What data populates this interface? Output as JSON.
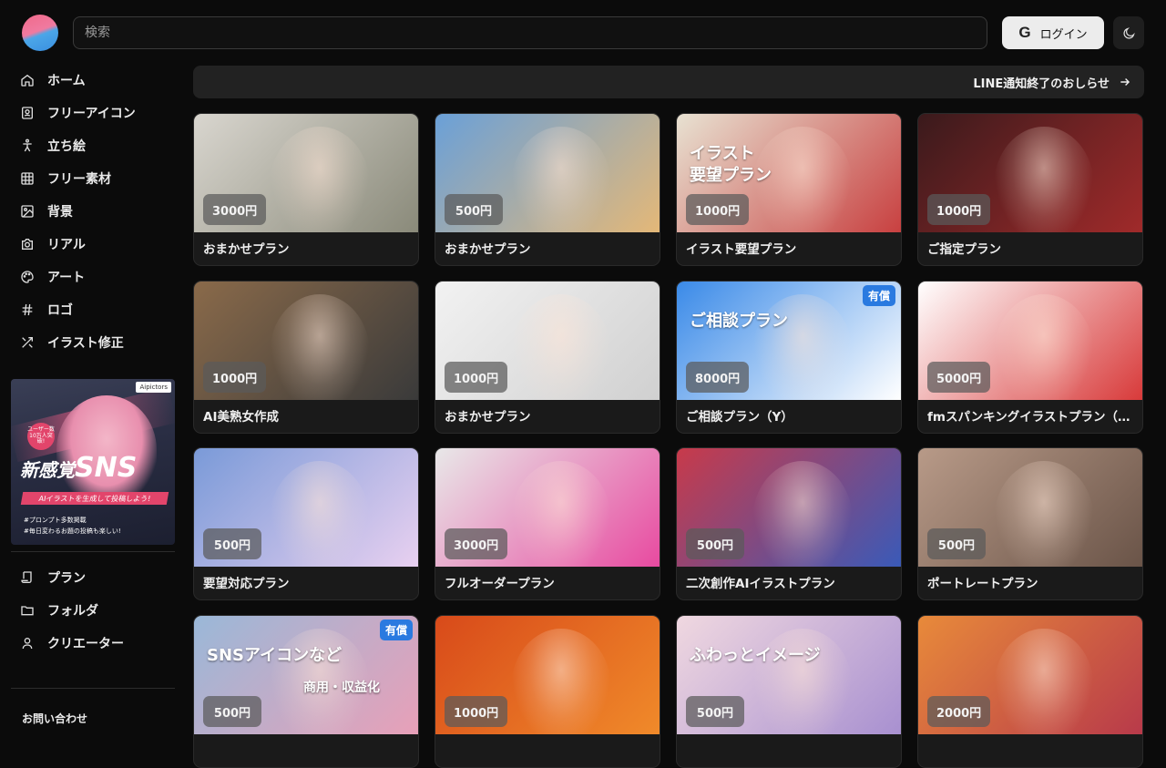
{
  "header": {
    "search_placeholder": "検索",
    "login_label": "ログイン",
    "login_icon": "google-icon",
    "theme_icon": "moon-icon"
  },
  "sidebar": {
    "items": [
      {
        "label": "ホーム",
        "icon": "home-icon"
      },
      {
        "label": "フリーアイコン",
        "icon": "portrait-icon"
      },
      {
        "label": "立ち絵",
        "icon": "standing-figure-icon"
      },
      {
        "label": "フリー素材",
        "icon": "grid-icon"
      },
      {
        "label": "背景",
        "icon": "image-icon"
      },
      {
        "label": "リアル",
        "icon": "camera-icon"
      },
      {
        "label": "アート",
        "icon": "palette-icon"
      },
      {
        "label": "ロゴ",
        "icon": "hash-icon"
      },
      {
        "label": "イラスト修正",
        "icon": "edit-tools-icon"
      }
    ],
    "promo": {
      "brand": "Aipictors",
      "badge": "ユーザー数10万人突破!",
      "headline_small": "新感覚",
      "headline_big": "SNS",
      "tagline": "AIイラストを生成して投稿しよう!",
      "note1": "#プロンプト多数掲載",
      "note2": "#毎日変わるお題の投稿も楽しい!"
    },
    "items2": [
      {
        "label": "プラン",
        "icon": "scroll-icon"
      },
      {
        "label": "フォルダ",
        "icon": "folder-icon"
      },
      {
        "label": "クリエーター",
        "icon": "user-icon"
      }
    ],
    "contact_label": "お問い合わせ"
  },
  "banner": {
    "label": "LINE通知終了のおしらせ",
    "icon": "arrow-right-icon"
  },
  "plans": [
    {
      "title": "おまかせプラン",
      "price": "3000円",
      "colors": [
        "#d9d6cf",
        "#8a8a7a"
      ]
    },
    {
      "title": "おまかせプラン",
      "price": "500円",
      "colors": [
        "#6aa0d8",
        "#e4b878"
      ]
    },
    {
      "title": "イラスト要望プラン",
      "price": "1000円",
      "colors": [
        "#e8e2d2",
        "#c84040"
      ],
      "overlay": "イラスト\n要望プラン"
    },
    {
      "title": "ご指定プラン",
      "price": "1000円",
      "colors": [
        "#3a1a1c",
        "#a02a2a"
      ]
    },
    {
      "title": "AI美熟女作成",
      "price": "1000円",
      "colors": [
        "#8a6a4a",
        "#3a3a3a"
      ]
    },
    {
      "title": "おまかせプラン",
      "price": "1000円",
      "colors": [
        "#f2f2f2",
        "#d0d0d0"
      ]
    },
    {
      "title": "ご相談プラン（Y）",
      "price": "8000円",
      "colors": [
        "#3a8ae8",
        "#ffffff"
      ],
      "overlay": "ご相談プラン",
      "tag": "有償"
    },
    {
      "title": "fmスパンキングイラストプラン（セ…",
      "price": "5000円",
      "colors": [
        "#ffffff",
        "#d83a3a"
      ]
    },
    {
      "title": "要望対応プラン",
      "price": "500円",
      "colors": [
        "#7a9ad8",
        "#e8d0f0"
      ]
    },
    {
      "title": "フルオーダープラン",
      "price": "3000円",
      "colors": [
        "#e8e8e8",
        "#e84aa0"
      ]
    },
    {
      "title": "二次創作AIイラストプラン",
      "price": "500円",
      "colors": [
        "#c83a4a",
        "#3a5ab8"
      ]
    },
    {
      "title": "ポートレートプラン",
      "price": "500円",
      "colors": [
        "#b89a88",
        "#6a5448"
      ]
    },
    {
      "title": "",
      "price": "500円",
      "colors": [
        "#9ab8d8",
        "#e8a0b8"
      ],
      "overlay": "SNSアイコンなど",
      "overlay2": "商用・収益化",
      "tag": "有償"
    },
    {
      "title": "",
      "price": "1000円",
      "colors": [
        "#d84a1a",
        "#f08a2a"
      ]
    },
    {
      "title": "",
      "price": "500円",
      "colors": [
        "#f0d8e0",
        "#a890d0"
      ],
      "overlay": "ふわっとイメージ"
    },
    {
      "title": "",
      "price": "2000円",
      "colors": [
        "#e88a3a",
        "#b83a4a"
      ]
    }
  ]
}
